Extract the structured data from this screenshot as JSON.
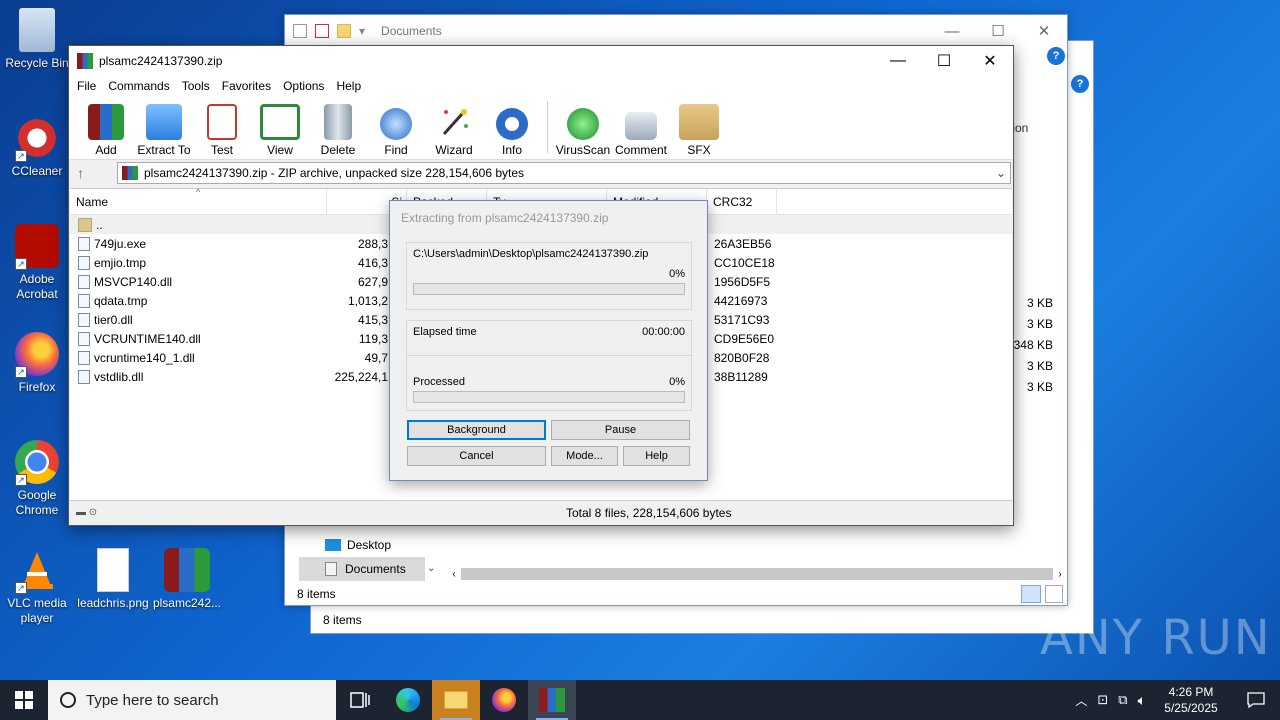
{
  "desktop": {
    "icons": [
      {
        "label": "Recycle Bin",
        "icon": "recycle-bin-icon"
      },
      {
        "label": "CCleaner",
        "icon": "ccleaner-icon"
      },
      {
        "label": "Adobe Acrobat",
        "icon": "adobe-acrobat-icon"
      },
      {
        "label": "Firefox",
        "icon": "firefox-icon"
      },
      {
        "label": "Google Chrome",
        "icon": "google-chrome-icon"
      },
      {
        "label": "VLC media player",
        "icon": "vlc-icon"
      },
      {
        "label": "leadchris.png",
        "icon": "image-file-icon"
      },
      {
        "label": "plsamc242...",
        "icon": "winrar-archive-icon"
      }
    ]
  },
  "explorer": {
    "title": "Documents",
    "help_label": "?",
    "side_fragment": "tion",
    "nav_items": [
      "Desktop",
      "Documents"
    ],
    "status": "8 items",
    "sizes": [
      "3 KB",
      "3 KB",
      "348 KB",
      "3 KB",
      "3 KB"
    ],
    "back_status": "8 items"
  },
  "winrar": {
    "title": "plsamc2424137390.zip",
    "menu": [
      "File",
      "Commands",
      "Tools",
      "Favorites",
      "Options",
      "Help"
    ],
    "toolbar": [
      "Add",
      "Extract To",
      "Test",
      "View",
      "Delete",
      "Find",
      "Wizard",
      "Info",
      "VirusScan",
      "Comment",
      "SFX"
    ],
    "address": "plsamc2424137390.zip - ZIP archive, unpacked size 228,154,606 bytes",
    "columns": [
      "Name",
      "Si",
      "Packed",
      "Ty",
      "Modified",
      "CRC32"
    ],
    "parent_label": "..",
    "files": [
      {
        "name": "749ju.exe",
        "size": "288,3",
        "crc": "26A3EB56"
      },
      {
        "name": "emjio.tmp",
        "size": "416,3",
        "crc": "CC10CE18"
      },
      {
        "name": "MSVCP140.dll",
        "size": "627,9",
        "crc": "1956D5F5"
      },
      {
        "name": "qdata.tmp",
        "size": "1,013,2",
        "crc": "44216973"
      },
      {
        "name": "tier0.dll",
        "size": "415,3",
        "crc": "53171C93"
      },
      {
        "name": "VCRUNTIME140.dll",
        "size": "119,3",
        "crc": "CD9E56E0"
      },
      {
        "name": "vcruntime140_1.dll",
        "size": "49,7",
        "crc": "820B0F28"
      },
      {
        "name": "vstdlib.dll",
        "size": "225,224,1",
        "crc": "38B11289"
      }
    ],
    "status_total": "Total 8 files, 228,154,606 bytes"
  },
  "dialog": {
    "title": "Extracting from plsamc2424137390.zip",
    "path": "C:\\Users\\admin\\Desktop\\plsamc2424137390.zip",
    "file_percent": "0%",
    "file_progress": 0,
    "elapsed_label": "Elapsed time",
    "elapsed_value": "00:00:00",
    "processed_label": "Processed",
    "processed_percent": "0%",
    "processed_progress": 0,
    "buttons": {
      "background": "Background",
      "pause": "Pause",
      "cancel": "Cancel",
      "mode": "Mode...",
      "help": "Help"
    }
  },
  "taskbar": {
    "search_placeholder": "Type here to search",
    "time": "4:26 PM",
    "date": "5/25/2025"
  },
  "watermark": "ANY RUN"
}
